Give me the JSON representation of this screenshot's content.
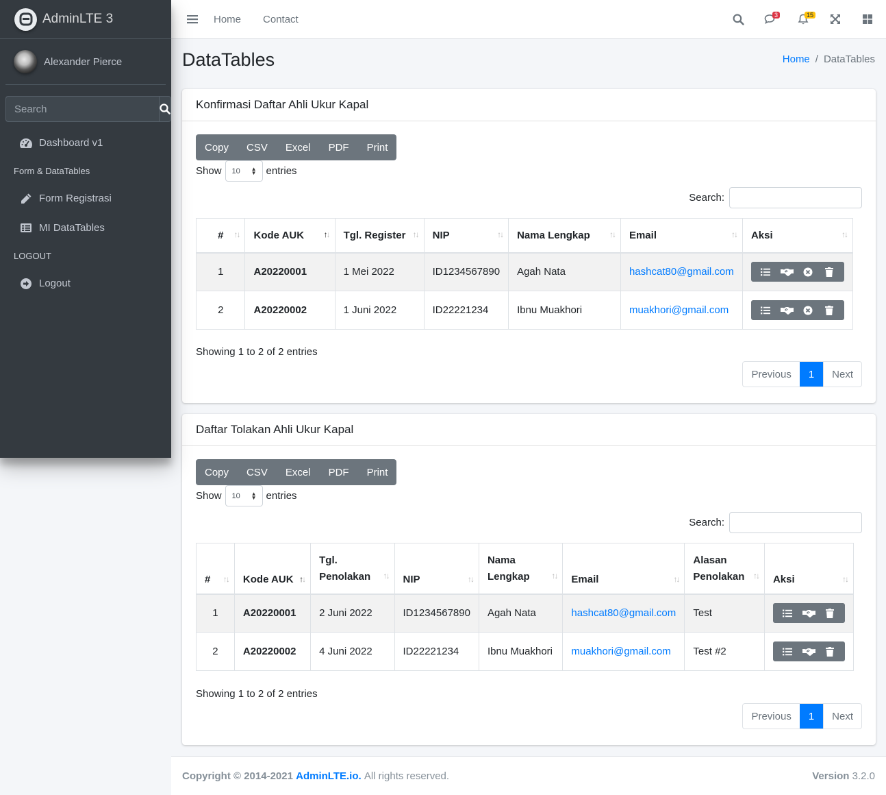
{
  "brand": {
    "name": "AdminLTE 3"
  },
  "user": {
    "name": "Alexander Pierce"
  },
  "sidebar": {
    "search_placeholder": "Search",
    "items": [
      {
        "label": "Dashboard v1",
        "icon": "tachometer-icon"
      },
      {
        "header": "Form & DataTables"
      },
      {
        "label": "Form Registrasi",
        "icon": "pencil-icon"
      },
      {
        "label": "MI DataTables",
        "icon": "list-table-icon"
      },
      {
        "header": "LOGOUT"
      },
      {
        "label": "Logout",
        "icon": "arrow-circle-right-icon"
      }
    ]
  },
  "topbar": {
    "links": [
      "Home",
      "Contact"
    ],
    "messages_badge": "3",
    "notifications_badge": "15"
  },
  "page": {
    "title": "DataTables",
    "breadcrumb": [
      "Home",
      "DataTables"
    ]
  },
  "export_buttons": [
    "Copy",
    "CSV",
    "Excel",
    "PDF",
    "Print"
  ],
  "length": {
    "show": "Show",
    "value": "10",
    "entries": "entries"
  },
  "search_label": "Search:",
  "card1": {
    "title": "Konfirmasi Daftar Ahli Ukur Kapal",
    "columns": [
      "#",
      "Kode AUK",
      "Tgl. Register",
      "NIP",
      "Nama Lengkap",
      "Email",
      "Aksi"
    ],
    "rows": [
      {
        "no": "1",
        "kode": "A20220001",
        "tgl": "1 Mei 2022",
        "nip": "ID1234567890",
        "nama": "Agah Nata",
        "email": "hashcat80@gmail.com"
      },
      {
        "no": "2",
        "kode": "A20220002",
        "tgl": "1 Juni 2022",
        "nip": "ID22221234",
        "nama": "Ibnu Muakhori",
        "email": "muakhori@gmail.com"
      }
    ],
    "info": "Showing 1 to 2 of 2 entries"
  },
  "card2": {
    "title": "Daftar Tolakan Ahli Ukur Kapal",
    "columns": [
      "#",
      "Kode AUK",
      "Tgl. Penolakan",
      "NIP",
      "Nama Lengkap",
      "Email",
      "Alasan Penolakan",
      "Aksi"
    ],
    "rows": [
      {
        "no": "1",
        "kode": "A20220001",
        "tgl": "2 Juni 2022",
        "nip": "ID1234567890",
        "nama": "Agah Nata",
        "email": "hashcat80@gmail.com",
        "alasan": "Test"
      },
      {
        "no": "2",
        "kode": "A20220002",
        "tgl": "4 Juni 2022",
        "nip": "ID22221234",
        "nama": "Ibnu Muakhori",
        "email": "muakhori@gmail.com",
        "alasan": "Test #2"
      }
    ],
    "info": "Showing 1 to 2 of 2 entries"
  },
  "pagination": {
    "prev": "Previous",
    "page": "1",
    "next": "Next"
  },
  "footer": {
    "copyright_prefix": "Copyright © 2014-2021",
    "brand_link": "AdminLTE.io.",
    "rights": "All rights reserved.",
    "version_label": "Version",
    "version": "3.2.0"
  },
  "colors": {
    "sidebar_bg": "#343a40",
    "primary": "#007bff",
    "secondary": "#6c757d",
    "danger": "#dc3545",
    "warning": "#ffc107"
  }
}
